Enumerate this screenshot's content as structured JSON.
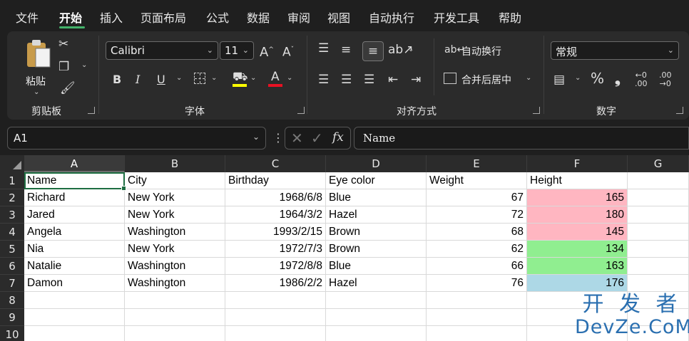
{
  "menu": [
    "文件",
    "开始",
    "插入",
    "页面布局",
    "公式",
    "数据",
    "审阅",
    "视图",
    "自动执行",
    "开发工具",
    "帮助"
  ],
  "ribbon": {
    "clipboard": {
      "paste_label": "粘贴",
      "group_label": "剪贴板"
    },
    "font": {
      "name": "Calibri",
      "size": "11",
      "group_label": "字体",
      "bold": "B",
      "italic": "I",
      "underline": "U",
      "grow": "A^",
      "shrink": "Aˇ",
      "color_letter": "A",
      "highlight_color": "#ffff00",
      "font_color": "#e81123"
    },
    "alignment": {
      "wrap_text": "自动换行",
      "merge_center": "合并后居中",
      "group_label": "对齐方式"
    },
    "number": {
      "format": "常规",
      "percent": "%",
      "comma": "❟",
      "group_label": "数字"
    }
  },
  "formula_bar": {
    "name_box": "A1",
    "fx": "fx",
    "content": "Name"
  },
  "columns": [
    "A",
    "B",
    "C",
    "D",
    "E",
    "F",
    "G"
  ],
  "rows": [
    "1",
    "2",
    "3",
    "4",
    "5",
    "6",
    "7",
    "8",
    "9",
    "10"
  ],
  "table": {
    "headers": [
      "Name",
      "City",
      "Birthday",
      "Eye color",
      "Weight",
      "Height"
    ],
    "records": [
      [
        "Richard",
        "New York",
        "1968/6/8",
        "Blue",
        "67",
        "165"
      ],
      [
        "Jared",
        "New York",
        "1964/3/2",
        "Hazel",
        "72",
        "180"
      ],
      [
        "Angela",
        "Washington",
        "1993/2/15",
        "Brown",
        "68",
        "145"
      ],
      [
        "Nia",
        "New York",
        "1972/7/3",
        "Brown",
        "62",
        "134"
      ],
      [
        "Natalie",
        "Washington",
        "1972/8/8",
        "Blue",
        "66",
        "163"
      ],
      [
        "Damon",
        "Washington",
        "1986/2/2",
        "Hazel",
        "76",
        "176"
      ]
    ],
    "height_fill_colors": [
      "#ffb6c1",
      "#ffb6c1",
      "#ffb6c1",
      "#90ee90",
      "#90ee90",
      "#add8e6"
    ]
  },
  "watermark": {
    "line1": "开 发 者",
    "line2": "DevZe.CoM"
  }
}
